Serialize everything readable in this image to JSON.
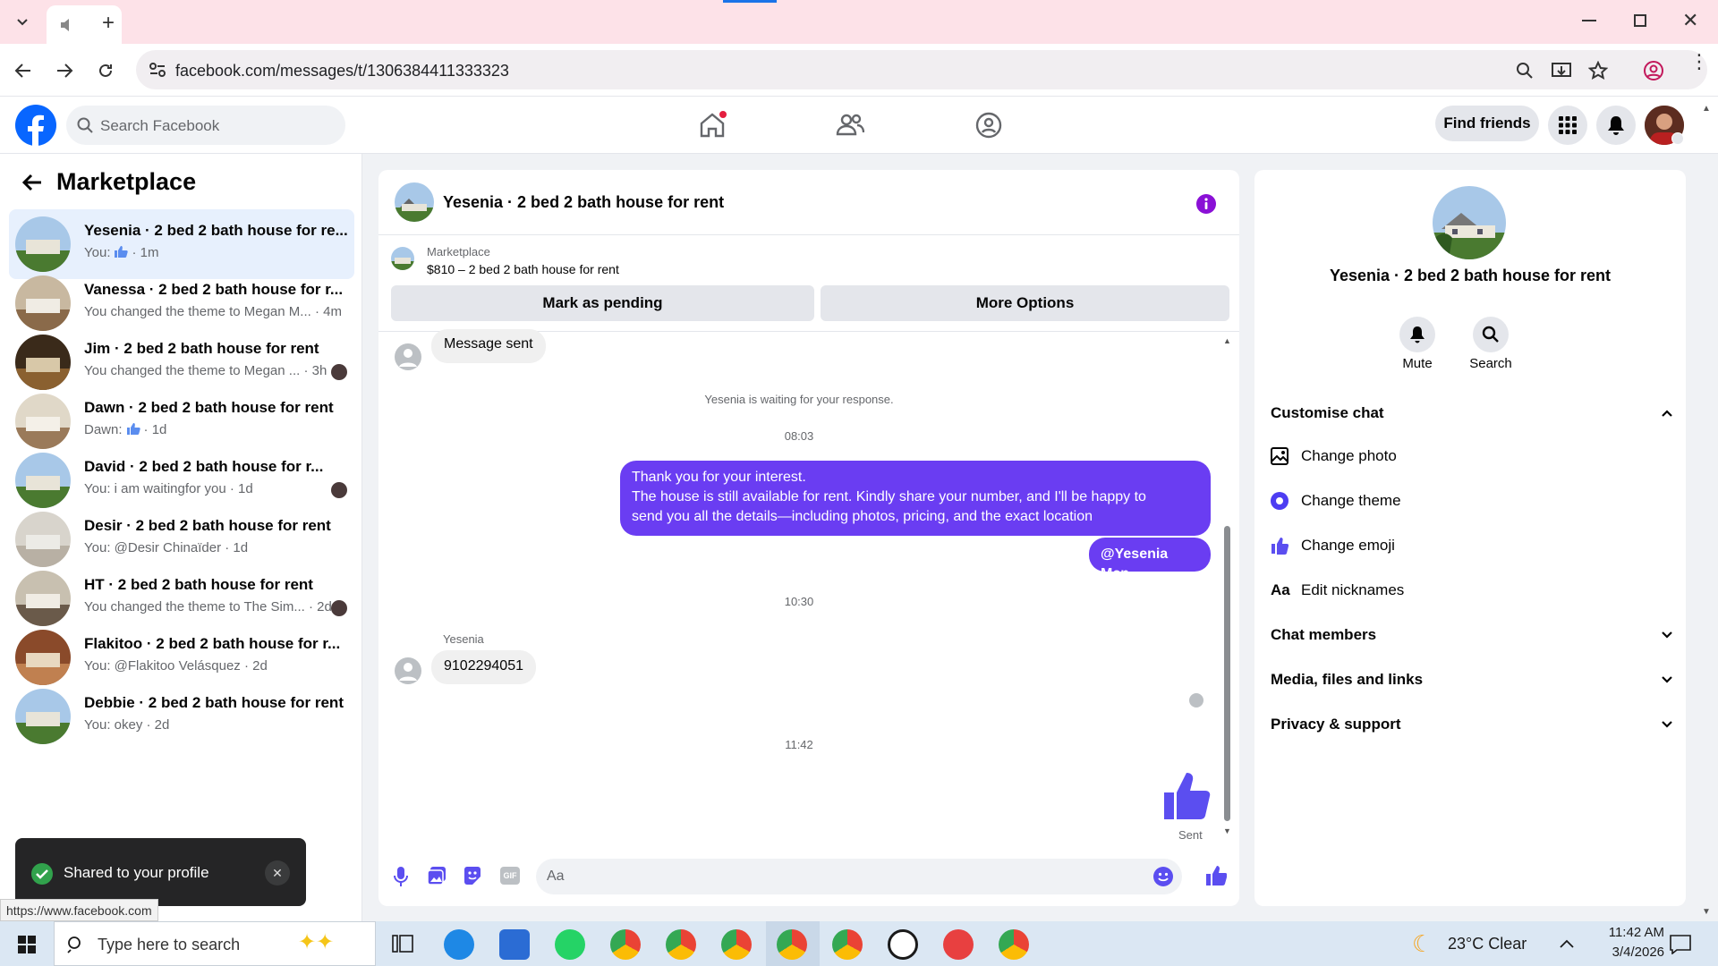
{
  "browser": {
    "url": "facebook.com/messages/t/1306384411333323",
    "status_url": "https://www.facebook.com"
  },
  "header": {
    "search_placeholder": "Search Facebook",
    "find_friends": "Find friends"
  },
  "sidebar": {
    "title": "Marketplace",
    "conversations": [
      {
        "title": "Yesenia · 2 bed 2 bath house for re...",
        "sub": "You:",
        "time": "· 1m",
        "emoji": true,
        "active": true
      },
      {
        "title": "Vanessa · 2 bed 2 bath house for r...",
        "sub": "You changed the theme to Megan M...",
        "time": "· 4m"
      },
      {
        "title": "Jim · 2 bed 2 bath house for rent",
        "sub": "You changed the theme to Megan ...",
        "time": "· 3h",
        "mini": true
      },
      {
        "title": "Dawn · 2 bed 2 bath house for rent",
        "sub": "Dawn:",
        "time": "· 1d",
        "emoji": true
      },
      {
        "title": "David · 2 bed 2 bath house for r...",
        "sub": "You: i am waitingfor you",
        "time": "· 1d",
        "mini": true
      },
      {
        "title": "Desir · 2 bed 2 bath house for rent",
        "sub": "You: @Desir Chinaïder",
        "time": "· 1d"
      },
      {
        "title": "HT · 2 bed 2 bath house for rent",
        "sub": "You changed the theme to The Sim...",
        "time": "· 2d",
        "mini": true
      },
      {
        "title": "Flakitoo · 2 bed 2 bath house for r...",
        "sub": "You: @Flakitoo Velásquez",
        "time": "· 2d"
      },
      {
        "title": "Debbie · 2 bed 2 bath house for rent",
        "sub": "You: okey",
        "time": "· 2d"
      }
    ]
  },
  "toast": {
    "text": "Shared to your profile"
  },
  "chat": {
    "title": "Yesenia · 2 bed 2 bath house for rent",
    "listing_source": "Marketplace",
    "listing_title": "$810 – 2 bed 2 bath house for rent",
    "mark_pending": "Mark as pending",
    "more_options": "More Options",
    "msg_sent_bubble": "Message sent",
    "waiting_note": "Yesenia is waiting for your response.",
    "time1": "08:03",
    "out_line1": "Thank you for your interest.",
    "out_line2": "The house is still available for rent. Kindly share your number, and I'll be happy to",
    "out_line3": "send you all the details—including photos, pricing, and the exact location",
    "mention": "@Yesenia Mcn",
    "time2": "10:30",
    "sender_name": "Yesenia",
    "phone_msg": "9102294051",
    "time3": "11:42",
    "sent_label": "Sent",
    "composer_placeholder": "Aa"
  },
  "info_panel": {
    "name": "Yesenia · 2 bed 2 bath house for rent",
    "mute": "Mute",
    "search": "Search",
    "customise": "Customise chat",
    "change_photo": "Change photo",
    "change_theme": "Change theme",
    "change_emoji": "Change emoji",
    "edit_nicknames": "Edit nicknames",
    "nick_icon": "Aa",
    "chat_members": "Chat members",
    "media": "Media, files and links",
    "privacy": "Privacy & support"
  },
  "taskbar": {
    "search_placeholder": "Type here to search",
    "weather": "23°C  Clear",
    "time": "11:42 AM",
    "date": "3/4/2026"
  },
  "colors": {
    "accent": "#6a3df2",
    "fb_blue": "#0866ff",
    "like_blue": "#5b4ef0"
  }
}
